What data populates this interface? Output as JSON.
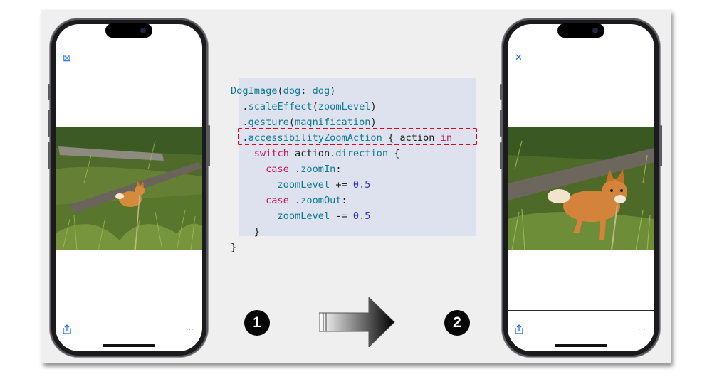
{
  "code": {
    "lines": [
      [
        {
          "t": "DogImage",
          "c": "fn"
        },
        {
          "t": "(",
          "c": ""
        },
        {
          "t": "dog",
          "c": "fn"
        },
        {
          "t": ": ",
          "c": ""
        },
        {
          "t": "dog",
          "c": "fn"
        },
        {
          "t": ")",
          "c": ""
        }
      ],
      [
        {
          "t": "  .",
          "c": ""
        },
        {
          "t": "scaleEffect",
          "c": "fn"
        },
        {
          "t": "(",
          "c": ""
        },
        {
          "t": "zoomLevel",
          "c": "fn"
        },
        {
          "t": ")",
          "c": ""
        }
      ],
      [
        {
          "t": "  .",
          "c": ""
        },
        {
          "t": "gesture",
          "c": "fn"
        },
        {
          "t": "(",
          "c": ""
        },
        {
          "t": "magnification",
          "c": "fn"
        },
        {
          "t": ")",
          "c": ""
        }
      ],
      [
        {
          "t": "  .",
          "c": ""
        },
        {
          "t": "accessibilityZoomAction",
          "c": "fn"
        },
        {
          "t": " { action ",
          "c": ""
        },
        {
          "t": "in",
          "c": "kw"
        }
      ],
      [
        {
          "t": "    ",
          "c": ""
        },
        {
          "t": "switch",
          "c": "kw"
        },
        {
          "t": " action.",
          "c": ""
        },
        {
          "t": "direction",
          "c": "fn"
        },
        {
          "t": " {",
          "c": ""
        }
      ],
      [
        {
          "t": "      ",
          "c": ""
        },
        {
          "t": "case",
          "c": "kw"
        },
        {
          "t": " .",
          "c": ""
        },
        {
          "t": "zoomIn",
          "c": "fn"
        },
        {
          "t": ":",
          "c": ""
        }
      ],
      [
        {
          "t": "        ",
          "c": ""
        },
        {
          "t": "zoomLevel",
          "c": "fn"
        },
        {
          "t": " += ",
          "c": ""
        },
        {
          "t": "0.5",
          "c": "num"
        }
      ],
      [
        {
          "t": "      ",
          "c": ""
        },
        {
          "t": "case",
          "c": "kw"
        },
        {
          "t": " .",
          "c": ""
        },
        {
          "t": "zoomOut",
          "c": "fn"
        },
        {
          "t": ":",
          "c": ""
        }
      ],
      [
        {
          "t": "        ",
          "c": ""
        },
        {
          "t": "zoomLevel",
          "c": "fn"
        },
        {
          "t": " -= ",
          "c": ""
        },
        {
          "t": "0.5",
          "c": "num"
        }
      ],
      [
        {
          "t": "    }",
          "c": ""
        }
      ],
      [
        {
          "t": "}",
          "c": ""
        }
      ]
    ]
  },
  "steps": {
    "first": "1",
    "second": "2"
  },
  "left_phone": {
    "close_glyph": "⊠",
    "more_glyph": "···"
  },
  "right_phone": {
    "close_glyph": "✕",
    "more_glyph": "···"
  },
  "colors": {
    "accent": "#1d6fe0",
    "keyword": "#c2185b",
    "function": "#0f7a93",
    "number": "#3730b8",
    "highlight_border": "#e0001a"
  }
}
